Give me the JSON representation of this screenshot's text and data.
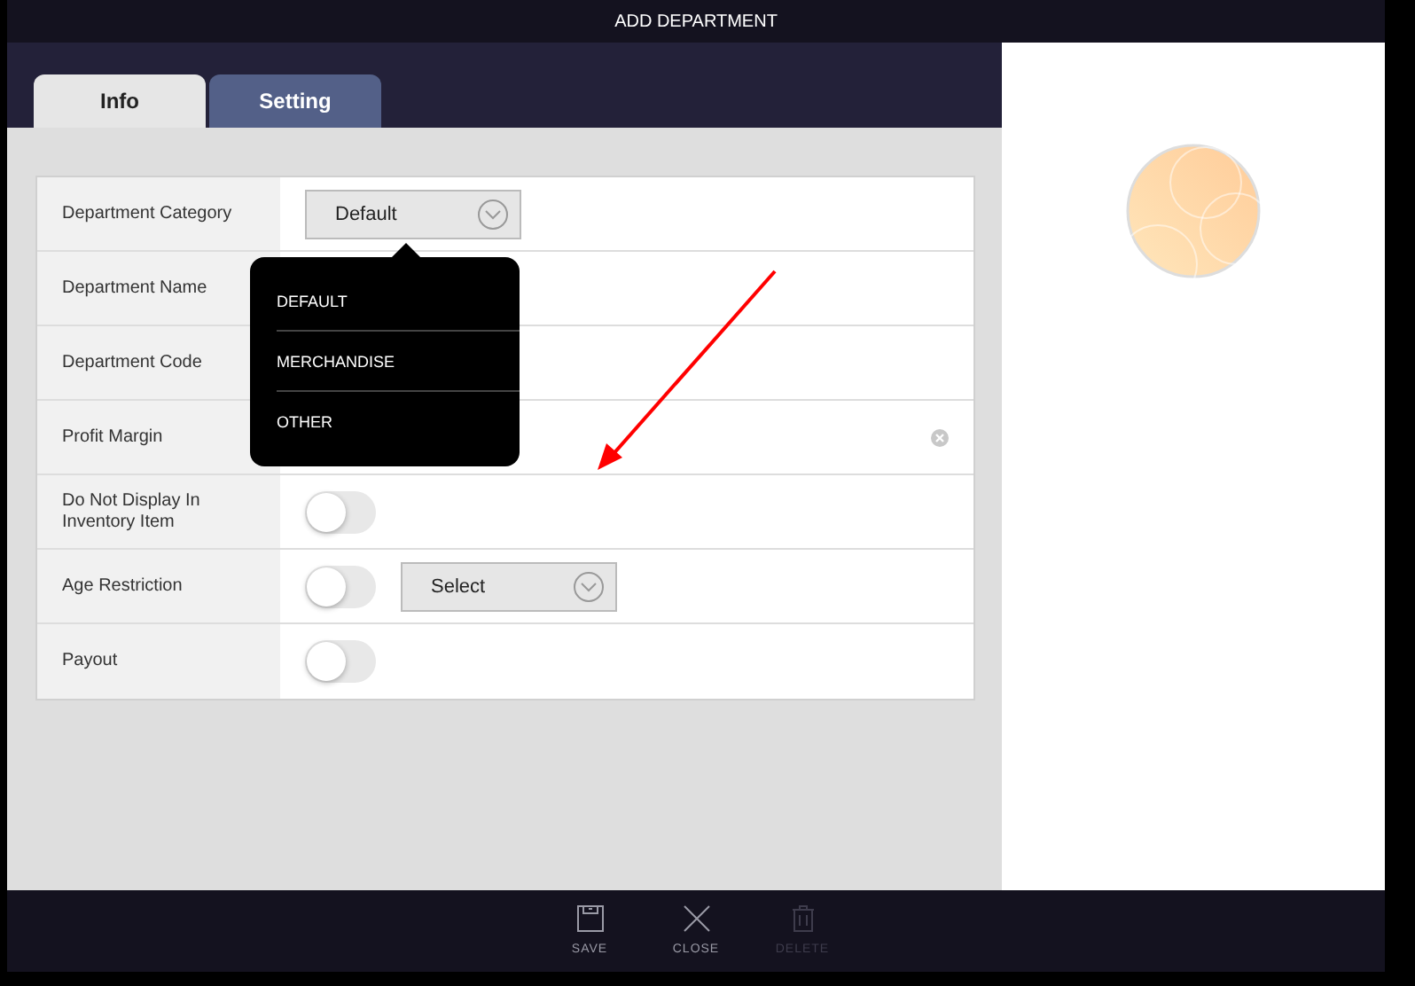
{
  "window": {
    "title": "ADD DEPARTMENT"
  },
  "tabs": [
    {
      "label": "Info",
      "selected": true
    },
    {
      "label": "Setting",
      "selected": false
    }
  ],
  "form": {
    "rows": [
      {
        "kind": "select",
        "label": "Department Category",
        "value": "Default"
      },
      {
        "kind": "text",
        "label": "Department Name"
      },
      {
        "kind": "text",
        "label": "Department Code"
      },
      {
        "kind": "clearable",
        "label": "Profit Margin"
      },
      {
        "kind": "toggle",
        "label": "Do Not Display In Inventory Item",
        "on": false
      },
      {
        "kind": "toggle_select",
        "label": "Age Restriction",
        "on": false,
        "value": "Select"
      },
      {
        "kind": "toggle",
        "label": "Payout",
        "on": false
      }
    ]
  },
  "dropdown": {
    "options": [
      {
        "label": "DEFAULT"
      },
      {
        "label": "MERCHANDISE"
      },
      {
        "label": "OTHER"
      }
    ]
  },
  "toolbar": [
    {
      "kind": "save",
      "label": "SAVE",
      "disabled": false
    },
    {
      "kind": "close",
      "label": "CLOSE",
      "disabled": false
    },
    {
      "kind": "delete",
      "label": "DELETE",
      "disabled": true
    }
  ]
}
